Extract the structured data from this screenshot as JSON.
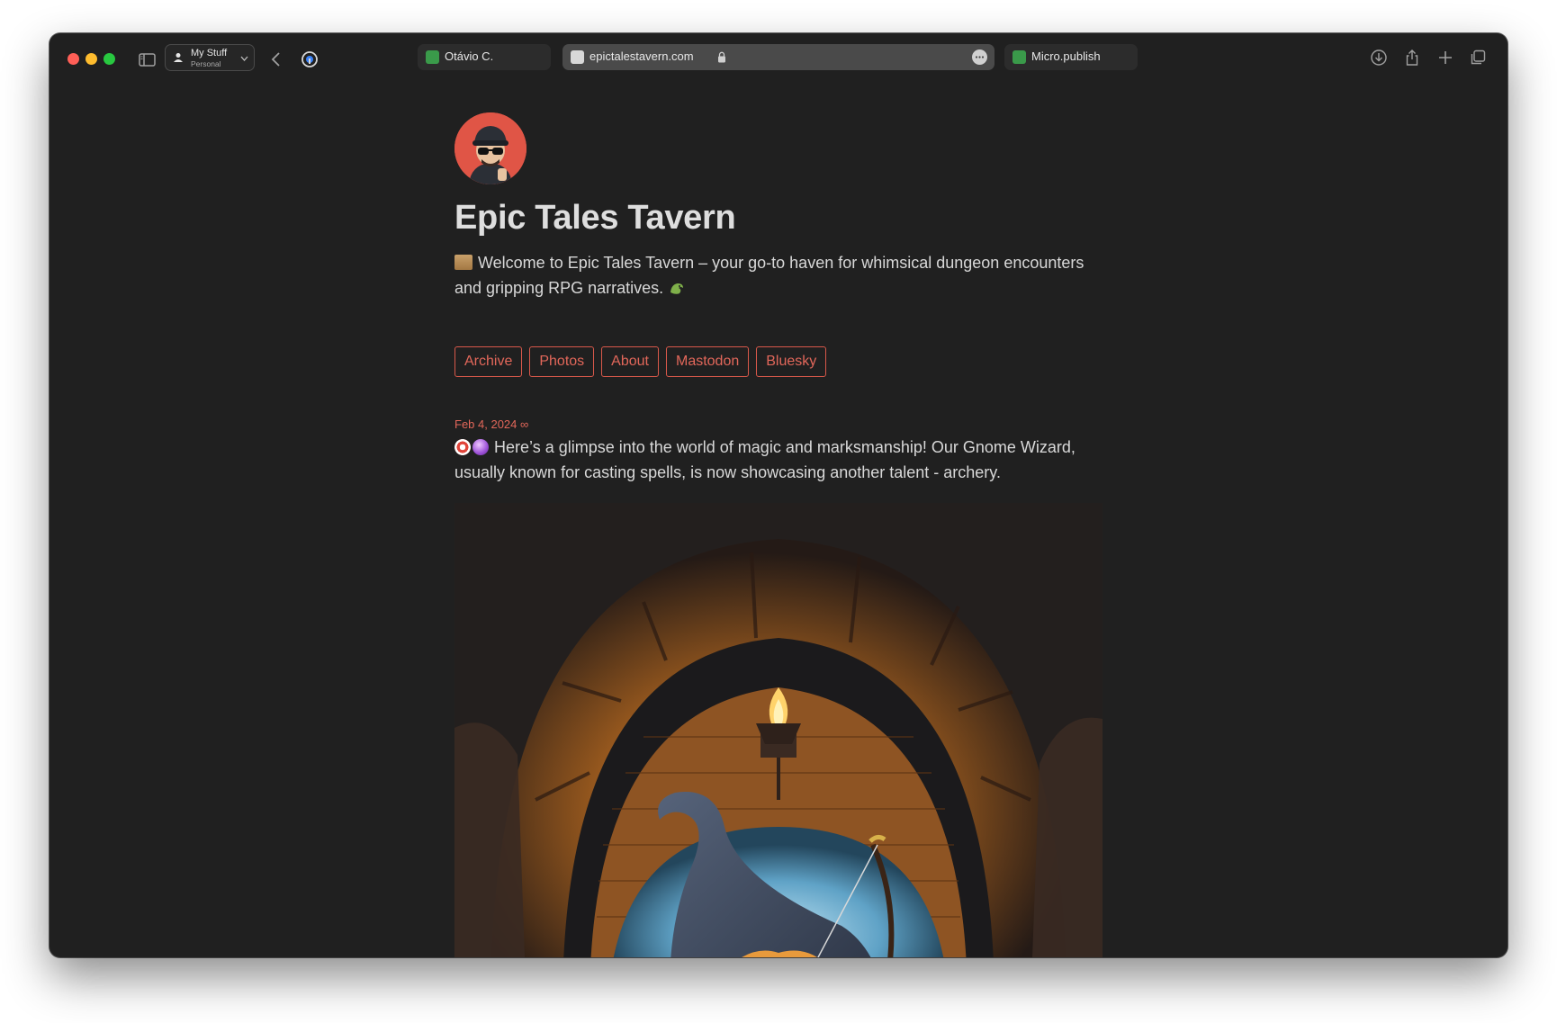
{
  "browser": {
    "profile_name": "My Stuff",
    "profile_sub": "Personal",
    "tabs": [
      {
        "label": "Otávio C."
      },
      {
        "label": "epictalestavern.com"
      },
      {
        "label": "Micro.publish"
      }
    ]
  },
  "site": {
    "title": "Epic Tales Tavern",
    "tagline": "Welcome to Epic Tales Tavern – your go-to haven for whimsical dungeon encounters and gripping RPG narratives.",
    "nav": [
      "Archive",
      "Photos",
      "About",
      "Mastodon",
      "Bluesky"
    ],
    "accent_color": "#e2675a",
    "avatar_bg": "#e05546"
  },
  "post": {
    "date": "Feb 4, 2024 ∞",
    "text": "Here’s a glimpse into the world of magic and marksmanship! Our Gnome Wizard, usually known for casting spells, is now showcasing another talent - archery."
  }
}
